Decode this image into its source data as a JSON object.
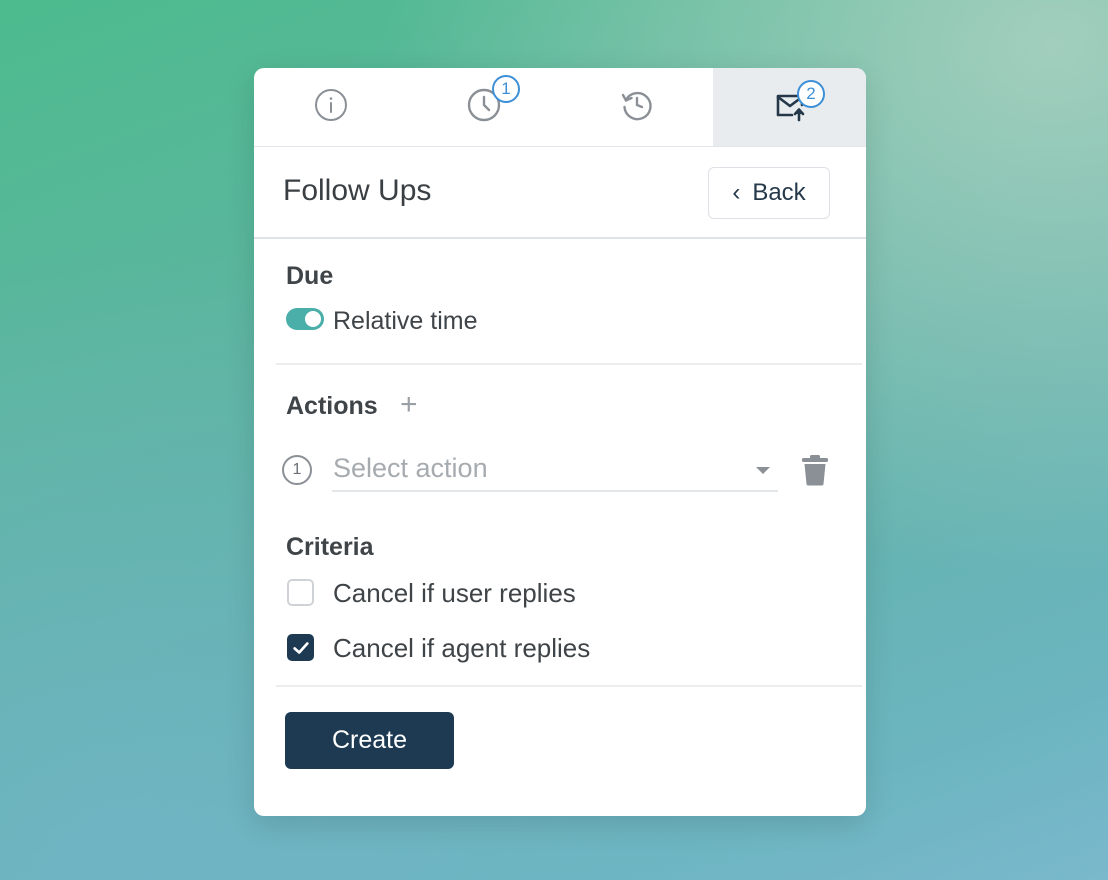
{
  "tabs": [
    {
      "icon": "info-icon",
      "badge": ""
    },
    {
      "icon": "clock-icon",
      "badge": "1"
    },
    {
      "icon": "history-icon",
      "badge": ""
    },
    {
      "icon": "mail-send-icon",
      "badge": "2",
      "active": true
    }
  ],
  "header": {
    "title": "Follow Ups",
    "back_label": "Back"
  },
  "due": {
    "label": "Due",
    "toggle_label": "Relative time",
    "toggle_on": true
  },
  "actions": {
    "label": "Actions",
    "add_glyph": "+",
    "items": [
      {
        "number": "1",
        "placeholder": "Select action"
      }
    ]
  },
  "criteria": {
    "label": "Criteria",
    "options": [
      {
        "label": "Cancel if user replies",
        "checked": false
      },
      {
        "label": "Cancel if agent replies",
        "checked": true
      }
    ]
  },
  "footer": {
    "create_label": "Create"
  },
  "colors": {
    "primary": "#1d3a52",
    "toggle": "#4aaea9",
    "badge": "#3d8fd6"
  }
}
